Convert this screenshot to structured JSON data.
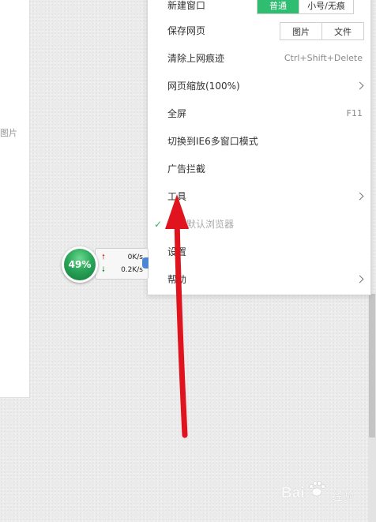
{
  "page_panel": {
    "partial_text": "图片"
  },
  "menu": {
    "new_window": {
      "label": "新建窗口",
      "options": [
        "普通",
        "小号/无痕"
      ]
    },
    "save_page": {
      "label": "保存网页",
      "options": [
        "图片",
        "文件"
      ]
    },
    "clear_history": {
      "label": "清除上网痕迹",
      "shortcut": "Ctrl+Shift+Delete"
    },
    "zoom": {
      "label": "网页缩放(100%)"
    },
    "fullscreen": {
      "label": "全屏",
      "shortcut": "F11"
    },
    "ie6_mode": {
      "label": "切换到IE6多窗口模式"
    },
    "ad_block": {
      "label": "广告拦截"
    },
    "tools": {
      "label": "工具"
    },
    "default_browser": {
      "label": "设为默认浏览器",
      "checked": true
    },
    "settings": {
      "label": "设置"
    },
    "help": {
      "label": "帮助"
    }
  },
  "speed_widget": {
    "percent": "49%",
    "upload": "0K/s",
    "download": "0.2K/s"
  },
  "watermark": {
    "brand": "Bai",
    "suffix": "经验"
  },
  "colors": {
    "accent_green": "#2fbd71",
    "annotation_red": "#e0141e",
    "ball_green": "#2aa659"
  }
}
